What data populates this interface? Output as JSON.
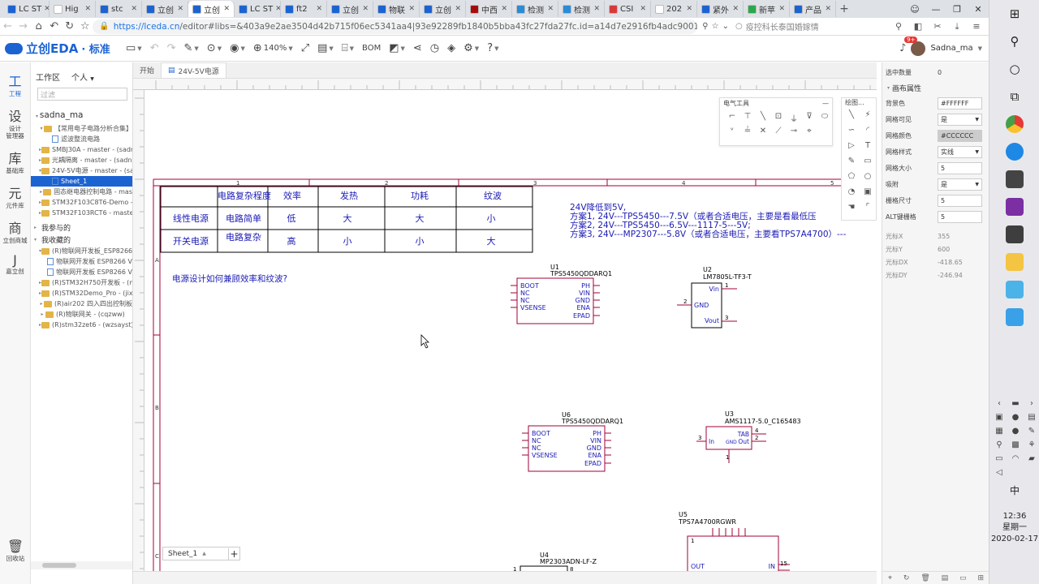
{
  "browser": {
    "tabs": [
      {
        "label": "LC ST",
        "color": "#1c63d2"
      },
      {
        "label": "Hig",
        "color": "#ffffff"
      },
      {
        "label": "stc",
        "color": "#1c63d2"
      },
      {
        "label": "立创",
        "color": "#1c63d2"
      },
      {
        "label": "立创",
        "color": "#1c63d2",
        "active": true
      },
      {
        "label": "LC ST",
        "color": "#1c63d2"
      },
      {
        "label": "ft2",
        "color": "#1c63d2"
      },
      {
        "label": "立创",
        "color": "#1c63d2"
      },
      {
        "label": "物联",
        "color": "#1c63d2"
      },
      {
        "label": "立创",
        "color": "#1c63d2"
      },
      {
        "label": "中西",
        "color": "#a50d0d"
      },
      {
        "label": "检测",
        "color": "#2a8bd8"
      },
      {
        "label": "检测",
        "color": "#2a8bd8"
      },
      {
        "label": "CSI",
        "color": "#d83a3a"
      },
      {
        "label": "202",
        "color": "#ffffff"
      },
      {
        "label": "紧外",
        "color": "#1c63d2"
      },
      {
        "label": "新苹",
        "color": "#2aa84a"
      },
      {
        "label": "产品",
        "color": "#1c63d2"
      }
    ],
    "new_tab": "+",
    "url_scheme": "https://",
    "url_host": "lceda.cn",
    "url_path": "/editor#libs=&403a9e2ae3504d42b715f06ec5341aa4|93e92289fb1840b5bba43fc27fda27fc.id=a14d7e2916fb4adc9001b09",
    "search_ext": "疫控科长泰国婚嫁情"
  },
  "eda": {
    "brand": "立创EDA",
    "edition": "· 标准",
    "zoom": "140%",
    "bom_label": "BOM",
    "notif_count": "9+",
    "user_name": "Sadna_ma"
  },
  "rail": [
    {
      "icon": "工",
      "label": "工程",
      "active": true
    },
    {
      "icon": "设",
      "label": "设计\n管理器"
    },
    {
      "icon": "库",
      "label": "基础库"
    },
    {
      "icon": "元",
      "label": "元件库"
    },
    {
      "icon": "商",
      "label": "立创商城"
    },
    {
      "icon": "J",
      "label": "嘉立创"
    }
  ],
  "rail_bottom": {
    "label": "回收站"
  },
  "tree": {
    "tab_workspace": "工作区",
    "tab_personal": "个人",
    "filter_placeholder": "过滤",
    "user": "sadna_ma",
    "nodes": [
      {
        "label": "【常用电子电路分析合集】",
        "type": "folder",
        "toggle": "▾",
        "indent": 1
      },
      {
        "label": "滤波整流电路",
        "type": "doc",
        "indent": 2
      },
      {
        "label": "SMBJ30A - master - (sadna",
        "type": "folder",
        "toggle": "▸",
        "indent": 1
      },
      {
        "label": "光耦隔离 - master - (sadna",
        "type": "folder",
        "toggle": "▸",
        "indent": 1
      },
      {
        "label": "24V-5V电源 - master - (sad",
        "type": "folder",
        "toggle": "▾",
        "indent": 1
      },
      {
        "label": "Sheet_1",
        "type": "doc",
        "indent": 2,
        "selected": true
      },
      {
        "label": "固态继电器控制电路 - mas",
        "type": "folder",
        "toggle": "▸",
        "indent": 1
      },
      {
        "label": "STM32F103C8T6-Demo -",
        "type": "folder",
        "toggle": "▸",
        "indent": 1
      },
      {
        "label": "STM32F103RCT6 - maste",
        "type": "folder",
        "toggle": "▸",
        "indent": 1
      }
    ],
    "section_joined": "我参与的",
    "section_favorites": "我收藏的",
    "fav_nodes": [
      {
        "label": "(R)物联网开发板_ESP8266",
        "type": "folder",
        "toggle": "▾",
        "indent": 1
      },
      {
        "label": "物联网开发板 ESP8266 V",
        "type": "doc",
        "indent": 2
      },
      {
        "label": "物联网开发板 ESP8266 V",
        "type": "doc",
        "indent": 2
      },
      {
        "label": "(R)STM32H750开发板 - (n",
        "type": "folder",
        "toggle": "▸",
        "indent": 1
      },
      {
        "label": "(R)STM32Demo_Pro - (jixu",
        "type": "folder",
        "toggle": "▸",
        "indent": 1
      },
      {
        "label": "(R)air202 四入四出控制板",
        "type": "folder",
        "toggle": "▸",
        "indent": 1
      },
      {
        "label": "(R)物联网关 - (cqzww)",
        "type": "folder",
        "toggle": "▸",
        "indent": 1
      },
      {
        "label": "(R)stm32zet6 - (wzsayst)",
        "type": "folder",
        "toggle": "▸",
        "indent": 1
      }
    ]
  },
  "doc_tabs": [
    {
      "label": "开始",
      "active": false
    },
    {
      "label": "24V-5V电源",
      "active": true
    }
  ],
  "sheet_tab": "Sheet_1",
  "electrical_tools": {
    "title": "电气工具"
  },
  "drawing_tools": {
    "title": "绘图..."
  },
  "properties": {
    "selected_count_label": "选中数量",
    "selected_count": "0",
    "section": "画布属性",
    "rows": [
      {
        "key": "背景色",
        "value": "#FFFFFF",
        "dropdown": false
      },
      {
        "key": "网格可见",
        "value": "是",
        "dropdown": true
      },
      {
        "key": "网格颜色",
        "value": "#CCCCCC",
        "dropdown": false,
        "gray": true
      },
      {
        "key": "网格样式",
        "value": "实线",
        "dropdown": true
      },
      {
        "key": "网格大小",
        "value": "5",
        "dropdown": false
      },
      {
        "key": "吸附",
        "value": "是",
        "dropdown": true
      },
      {
        "key": "栅格尺寸",
        "value": "5",
        "dropdown": false
      },
      {
        "key": "ALT键栅格",
        "value": "5",
        "dropdown": false
      }
    ],
    "readonly": [
      {
        "key": "光标X",
        "value": "355"
      },
      {
        "key": "光标Y",
        "value": "600"
      },
      {
        "key": "光标DX",
        "value": "-418.65"
      },
      {
        "key": "光标DY",
        "value": "-246.94"
      }
    ]
  },
  "schematic": {
    "table": {
      "header": [
        "电路复杂程度",
        "效率",
        "发热",
        "功耗",
        "纹波"
      ],
      "rows": [
        [
          "线性电源",
          "电路简单",
          "低",
          "大",
          "大",
          "小"
        ],
        [
          "开关电源",
          "电路复杂",
          "高",
          "小",
          "小",
          "大"
        ]
      ]
    },
    "notes": [
      "24V降低到5V,",
      "方案1, 24V---TPS5450---7.5V（或者合适电压，主要是看最低压",
      "方案2, 24V---TPS5450---6.5V---1117-5---5V;",
      "方案3, 24V---MP2307---5.8V（或者合适电压，主要看TPS7A4700）---"
    ],
    "question": "电源设计如何兼顾效率和纹波?",
    "frame_cols": [
      "1",
      "2",
      "3",
      "4",
      "5"
    ],
    "frame_rows": [
      "A",
      "B",
      "C"
    ],
    "u1": {
      "ref": "U1",
      "part": "TPS5450QDDARQ1",
      "left_pins": [
        "BOOT",
        "NC",
        "NC",
        "VSENSE"
      ],
      "right_pins": [
        "PH",
        "VIN",
        "GND",
        "ENA",
        "EPAD"
      ]
    },
    "u6": {
      "ref": "U6",
      "part": "TPS5450QDDARQ1",
      "left_pins": [
        "BOOT",
        "NC",
        "NC",
        "VSENSE"
      ],
      "right_pins": [
        "PH",
        "VIN",
        "GND",
        "ENA",
        "EPAD"
      ]
    },
    "u2": {
      "ref": "U2",
      "part": "LM7805L-TF3-T",
      "pins": [
        "Vin",
        "GND",
        "Vout"
      ],
      "nums": [
        "1",
        "2",
        "3"
      ]
    },
    "u3": {
      "ref": "U3",
      "part": "AMS1117-5.0_C165483",
      "pins": [
        "In",
        "GND",
        "Out",
        "TAB",
        "Out"
      ],
      "nums": [
        "3",
        "4",
        "2",
        "1"
      ]
    },
    "u5": {
      "ref": "U5",
      "part": "TPS7A4700RGWR",
      "pins": [
        "OUT",
        "IN"
      ],
      "nums": [
        "1",
        "15"
      ]
    },
    "u4": {
      "ref": "U4",
      "part": "MP2303ADN-LF-Z",
      "nums": [
        "1",
        "8"
      ]
    }
  },
  "taskbar": {
    "lang": "中",
    "time": "12:36",
    "weekday": "星期一",
    "date": "2020-02-17"
  }
}
